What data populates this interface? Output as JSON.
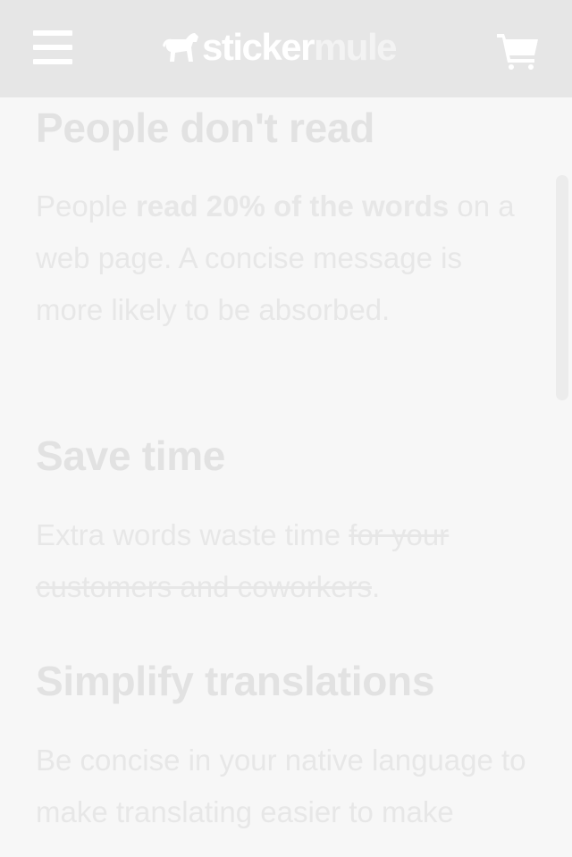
{
  "header": {
    "brand_part1": "sticker",
    "brand_part2": "mule"
  },
  "sections": [
    {
      "title": "People don't read",
      "text_before": "People ",
      "text_bold": "read 20% of the words",
      "text_after": " on a web page. A concise message is more likely to be absorbed."
    },
    {
      "title": "Save time",
      "text_before": "Extra words waste time ",
      "text_struck": "for your customers and coworkers",
      "text_after": "."
    },
    {
      "title": "Simplify translations",
      "text": "Be concise in your native language to make translating easier to make"
    }
  ],
  "colors": {
    "header_bg": "#e6e6e6",
    "page_bg": "#f7f7f7",
    "text": "#e7e7e7",
    "icon": "#ffffff"
  },
  "icons": {
    "menu": "hamburger-menu-icon",
    "logo": "mule-icon",
    "cart": "shopping-cart-icon"
  }
}
